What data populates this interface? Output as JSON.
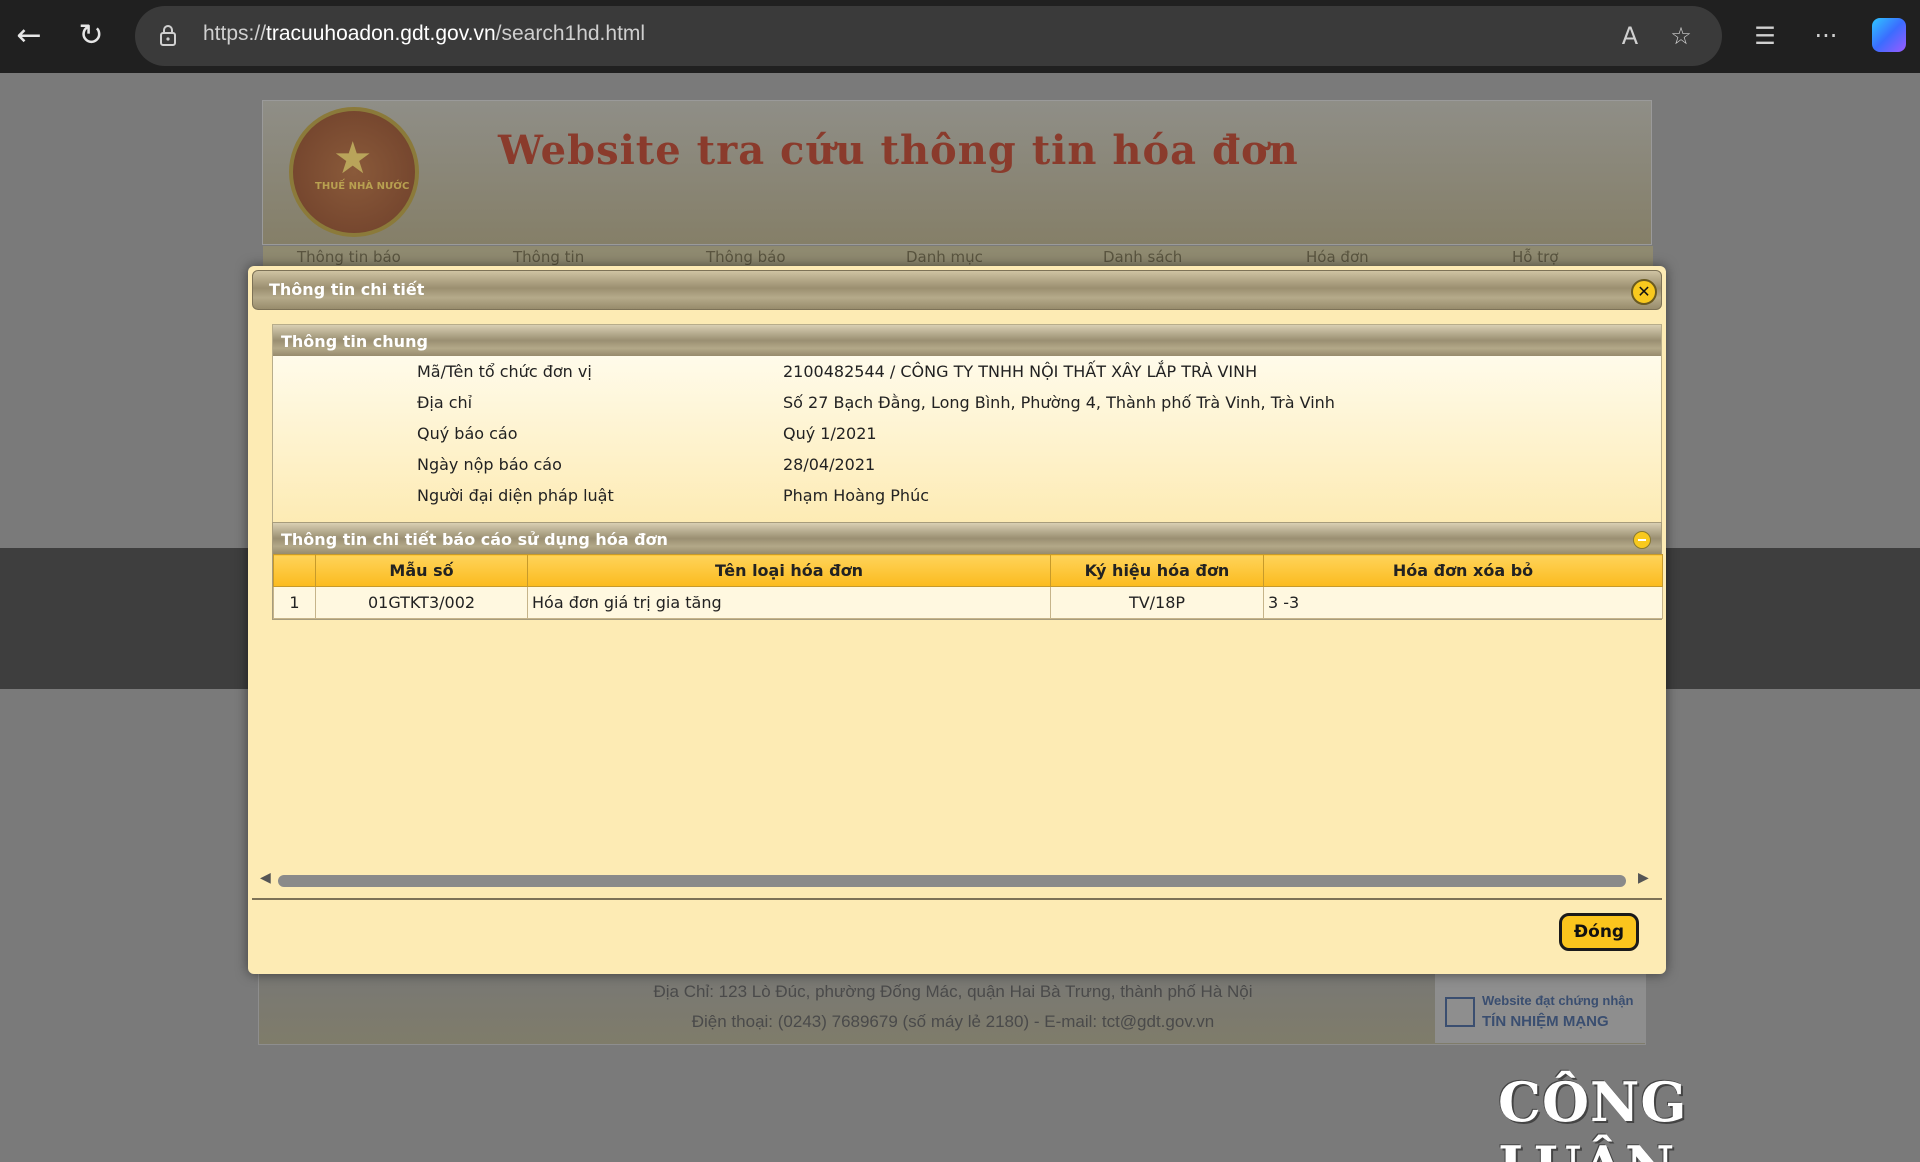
{
  "browser": {
    "url_prefix": "https://",
    "url_host": "tracuuhoadon.gdt.gov.vn",
    "url_path": "/search1hd.html"
  },
  "site": {
    "title": "Website tra cứu thông tin hóa đơn",
    "emblem_text": "THUẾ NHÀ NƯỚC",
    "nav": [
      "Thông tin báo",
      "Thông tin",
      "Thông báo",
      "Danh mục",
      "Danh sách",
      "Hóa đơn",
      "Hỗ trợ"
    ],
    "footer_address": "Địa Chỉ: 123 Lò Đúc, phường Đống Mác, quận Hai Bà Trưng, thành phố Hà Nội",
    "footer_contact": "Điện thoại: (0243) 7689679 (số máy lẻ 2180) - E-mail: tct@gdt.gov.vn",
    "badge_line1": "Website đạt chứng nhận",
    "badge_line2": "TÍN NHIỆM MẠNG"
  },
  "modal": {
    "title": "Thông tin chi tiết",
    "general_section": "Thông tin chung",
    "fields": [
      {
        "label": "Mã/Tên tổ chức đơn vị",
        "value": "2100482544 / CÔNG TY TNHH NỘI THẤT XÂY LẮP TRÀ VINH"
      },
      {
        "label": "Địa chỉ",
        "value": "Số 27 Bạch Đằng, Long Bình, Phường 4, Thành phố Trà Vinh, Trà Vinh"
      },
      {
        "label": "Quý báo cáo",
        "value": "Quý 1/2021"
      },
      {
        "label": "Ngày nộp báo cáo",
        "value": "28/04/2021"
      },
      {
        "label": "Người đại diện pháp luật",
        "value": "Phạm Hoàng Phúc"
      }
    ],
    "detail_section": "Thông tin chi tiết báo cáo sử dụng hóa đơn",
    "table": {
      "headers": [
        "",
        "Mẫu số",
        "Tên loại hóa đơn",
        "Ký hiệu hóa đơn",
        "Hóa đơn xóa bỏ"
      ],
      "rows": [
        [
          "1",
          "01GTKT3/002",
          "Hóa đơn giá trị gia tăng",
          "TV/18P",
          "3 -3"
        ]
      ]
    },
    "close_button": "Đóng"
  },
  "watermark": "CÔNG LUẬN",
  "colors": {
    "modal_bg": "#fdebb4",
    "header_gold": "#fbbb1e",
    "browser_bar": "#202020"
  }
}
